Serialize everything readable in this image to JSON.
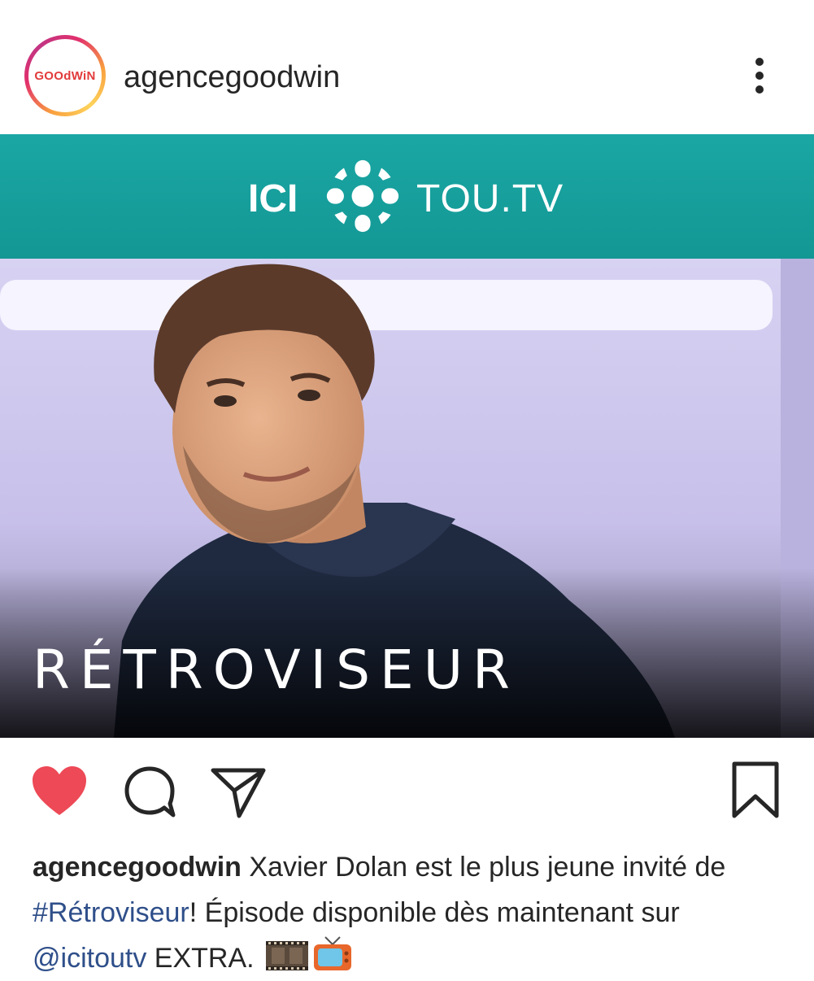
{
  "header": {
    "avatar_text": "GOOdWiN",
    "username": "agencegoodwin"
  },
  "post": {
    "banner_left": "ICI",
    "banner_right": "TOU.TV",
    "show_title": "RÉTROVISEUR"
  },
  "actions": {
    "liked": true,
    "like_color": "#ed4956"
  },
  "caption": {
    "username": "agencegoodwin",
    "text_1": " Xavier Dolan est le plus jeune invité de ",
    "hashtag": "#Rétroviseur",
    "text_2": "! Épisode disponible dès maintenant sur ",
    "mention": "@icitoutv",
    "text_3": " EXTRA.",
    "emojis": [
      "film-frames-icon",
      "television-icon"
    ]
  }
}
